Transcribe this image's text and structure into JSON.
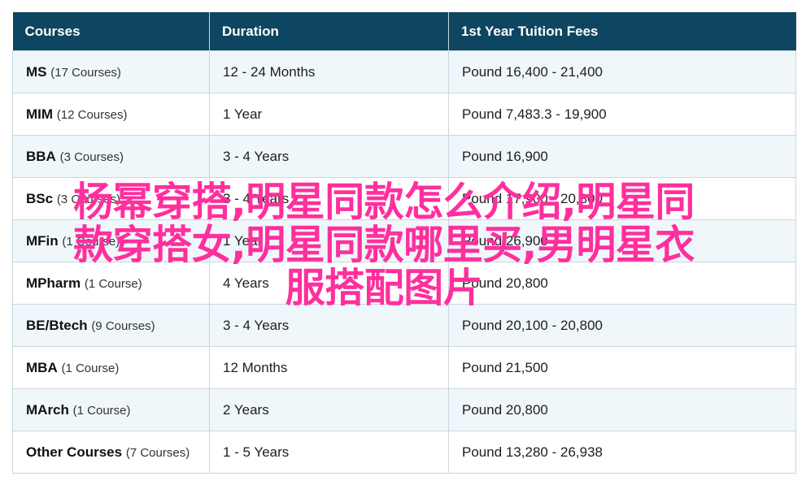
{
  "table": {
    "headers": [
      "Courses",
      "Duration",
      "1st Year Tuition Fees"
    ],
    "rows": [
      {
        "course": "MS",
        "count": "(17 Courses)",
        "duration": "12 - 24 Months",
        "fees": "Pound 16,400 - 21,400"
      },
      {
        "course": "MIM",
        "count": "(12 Courses)",
        "duration": "1 Year",
        "fees": "Pound 7,483.3 - 19,900"
      },
      {
        "course": "BBA",
        "count": "(3 Courses)",
        "duration": "3 - 4 Years",
        "fees": "Pound 16,900"
      },
      {
        "course": "BSc",
        "count": "(3 Courses)",
        "duration": "3 - 4 Years",
        "fees": "Pound 17,900 - 20,800"
      },
      {
        "course": "MFin",
        "count": "(1 Course)",
        "duration": "1 Year",
        "fees": "Pound 26,900"
      },
      {
        "course": "MPharm",
        "count": "(1 Course)",
        "duration": "4 Years",
        "fees": "Pound 20,800"
      },
      {
        "course": "BE/Btech",
        "count": "(9 Courses)",
        "duration": "3 - 4 Years",
        "fees": "Pound 20,100 - 20,800"
      },
      {
        "course": "MBA",
        "count": "(1 Course)",
        "duration": "12 Months",
        "fees": "Pound 21,500"
      },
      {
        "course": "MArch",
        "count": "(1 Course)",
        "duration": "2 Years",
        "fees": "Pound 20,800"
      },
      {
        "course": "Other Courses",
        "count": "(7 Courses)",
        "duration": "1 - 5 Years",
        "fees": "Pound 13,280 - 26,938"
      }
    ]
  },
  "overlay": {
    "lines": [
      "杨幂穿搭,明星同款怎么介绍,明星同",
      "款穿搭女,明星同款哪里买,男明星衣",
      "服搭配图片"
    ],
    "color": "#ff2f9d"
  },
  "colors": {
    "header_bg": "#0e4560",
    "row_alt_bg": "#f0f7fb",
    "border": "#c9d6de"
  }
}
